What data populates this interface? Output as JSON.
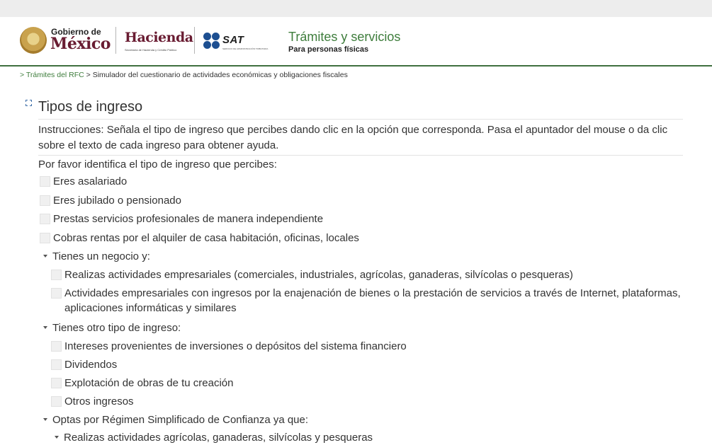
{
  "header": {
    "gob_small": "Gobierno de",
    "gob_big": "México",
    "hacienda_title": "Hacienda",
    "hacienda_sub": "Secretaría de Hacienda y Crédito Público",
    "sat_label": "SAT",
    "sat_sub": "SERVICIO DE ADMINISTRACIÓN TRIBUTARIA",
    "tramites_title": "Trámites y servicios",
    "tramites_sub": "Para personas físicas"
  },
  "breadcrumb": {
    "sep1": "> ",
    "link": "Trámites del RFC",
    "sep2": " > ",
    "current": "Simulador del cuestionario de actividades económicas y obligaciones fiscales"
  },
  "section": {
    "title": "Tipos de ingreso",
    "instructions": "Instrucciones: Señala el tipo de ingreso que percibes dando clic en la opción que corresponda. Pasa el apuntador del mouse o da clic sobre el texto de cada ingreso para obtener ayuda.",
    "prompt": "Por favor identifica el tipo de ingreso que percibes:"
  },
  "options": {
    "asalariado": "Eres asalariado",
    "jubilado": "Eres jubilado o pensionado",
    "profesionales": "Prestas servicios profesionales de manera independiente",
    "rentas": "Cobras rentas por el alquiler de casa habitación, oficinas, locales",
    "negocio_group": "Tienes un negocio y:",
    "empresariales": "Realizas actividades empresariales (comerciales, industriales, agrícolas, ganaderas, silvícolas o pesqueras)",
    "internet": "Actividades empresariales con ingresos por la enajenación de bienes o la prestación de servicios a través de Internet, plataformas, aplicaciones informáticas y similares",
    "otro_group": "Tienes otro tipo de ingreso:",
    "intereses": "Intereses provenientes de inversiones o depósitos del sistema financiero",
    "dividendos": "Dividendos",
    "explotacion": "Explotación de obras de tu creación",
    "otros": "Otros ingresos",
    "resico_group": "Optas por Régimen Simplificado de Confianza ya que:",
    "resico_sub": "Realizas actividades agrícolas, ganaderas, silvícolas y pesqueras"
  }
}
